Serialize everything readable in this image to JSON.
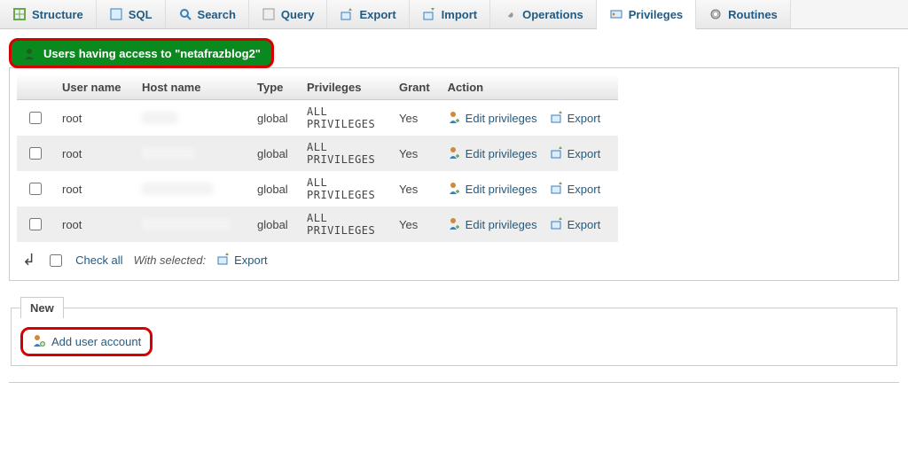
{
  "tabs": [
    {
      "label": "Structure",
      "icon": "structure"
    },
    {
      "label": "SQL",
      "icon": "sql"
    },
    {
      "label": "Search",
      "icon": "search"
    },
    {
      "label": "Query",
      "icon": "query"
    },
    {
      "label": "Export",
      "icon": "export"
    },
    {
      "label": "Import",
      "icon": "import"
    },
    {
      "label": "Operations",
      "icon": "wrench"
    },
    {
      "label": "Privileges",
      "icon": "privileges",
      "active": true
    },
    {
      "label": "Routines",
      "icon": "routines"
    }
  ],
  "section_title": "Users having access to \"netafrazblog2\"",
  "columns": {
    "user": "User name",
    "host": "Host name",
    "type": "Type",
    "priv": "Privileges",
    "grant": "Grant",
    "action": "Action"
  },
  "rows": [
    {
      "user": "root",
      "type": "global",
      "priv": "ALL PRIVILEGES",
      "grant": "Yes"
    },
    {
      "user": "root",
      "type": "global",
      "priv": "ALL PRIVILEGES",
      "grant": "Yes"
    },
    {
      "user": "root",
      "type": "global",
      "priv": "ALL PRIVILEGES",
      "grant": "Yes"
    },
    {
      "user": "root",
      "type": "global",
      "priv": "ALL PRIVILEGES",
      "grant": "Yes"
    }
  ],
  "action_labels": {
    "edit": "Edit privileges",
    "export": "Export"
  },
  "footer": {
    "check_all": "Check all",
    "with_selected": "With selected:",
    "export": "Export"
  },
  "new_section": {
    "legend": "New",
    "add_user": "Add user account"
  }
}
